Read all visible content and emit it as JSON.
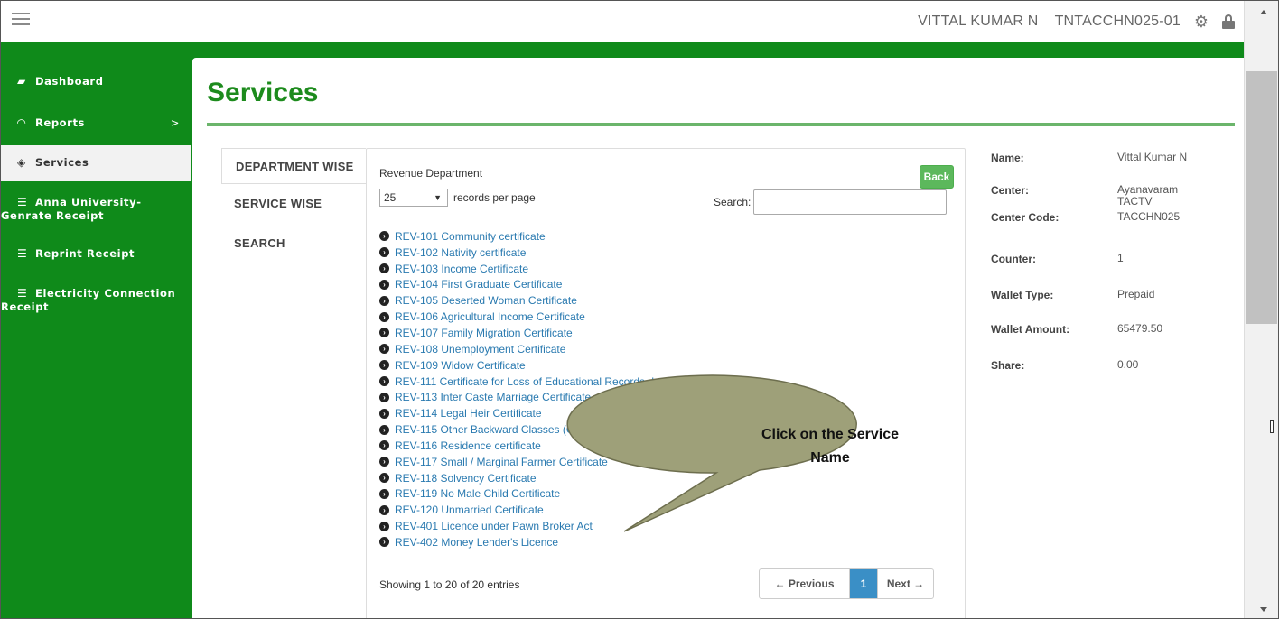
{
  "header": {
    "user_name": "VITTAL KUMAR N",
    "user_code": "TNTACCHN025-01",
    "icons": [
      "menu-icon",
      "gear-icon",
      "lock-icon"
    ]
  },
  "sidebar": {
    "items": [
      {
        "label": "Dashboard",
        "icon": "briefcase-icon"
      },
      {
        "label": "Reports",
        "icon": "gauge-icon",
        "chevron": ">"
      },
      {
        "label": "Services",
        "icon": "box-icon"
      },
      {
        "label": "Anna University-",
        "label2": "Genrate Receipt",
        "icon": "list-icon"
      },
      {
        "label": "Reprint Receipt",
        "icon": "list-icon"
      },
      {
        "label": "Electricity Connection",
        "label2": "Receipt",
        "icon": "list-icon"
      }
    ]
  },
  "page": {
    "title": "Services"
  },
  "tabs": [
    "DEPARTMENT WISE",
    "SERVICE WISE",
    "SEARCH"
  ],
  "content": {
    "department": "Revenue Department",
    "back_label": "Back",
    "records_per_page_value": "25",
    "records_per_page_label": "records per page",
    "search_label": "Search:",
    "search_value": "",
    "services": [
      "REV-101 Community certificate",
      "REV-102 Nativity certificate",
      "REV-103 Income Certificate",
      "REV-104 First Graduate Certificate",
      "REV-105 Deserted Woman Certificate",
      "REV-106 Agricultural Income Certificate",
      "REV-107 Family Migration Certificate",
      "REV-108 Unemployment Certificate",
      "REV-109 Widow Certificate",
      "REV-111 Certificate for Loss of Educational Records due to Disaster",
      "REV-113 Inter Caste Marriage Certificate",
      "REV-114 Legal Heir Certificate",
      "REV-115 Other Backward Classes (OBC) Certificate",
      "REV-116 Residence certificate",
      "REV-117 Small / Marginal Farmer Certificate",
      "REV-118 Solvency Certificate",
      "REV-119 No Male Child Certificate",
      "REV-120 Unmarried Certificate",
      "REV-401 Licence under Pawn Broker Act",
      "REV-402 Money Lender's Licence"
    ],
    "showing": "Showing 1 to 20 of 20 entries",
    "pager": {
      "prev": "← Previous",
      "current": "1",
      "next": "Next →"
    }
  },
  "info": [
    {
      "key": "Name:",
      "value": "Vittal Kumar N"
    },
    {
      "key": "Center:",
      "value": "Ayanavaram",
      "value2": "TACTV"
    },
    {
      "key": "Center Code:",
      "value": "TACCHN025"
    },
    {
      "key": "Counter:",
      "value": "1"
    },
    {
      "key": "Wallet Type:",
      "value": "Prepaid"
    },
    {
      "key": "Wallet Amount:",
      "value": "65479.50"
    },
    {
      "key": "Share:",
      "value": "0.00"
    }
  ],
  "callout": {
    "line1": "Click on the Service",
    "line2": "Name",
    "fill": "#9ea079"
  }
}
